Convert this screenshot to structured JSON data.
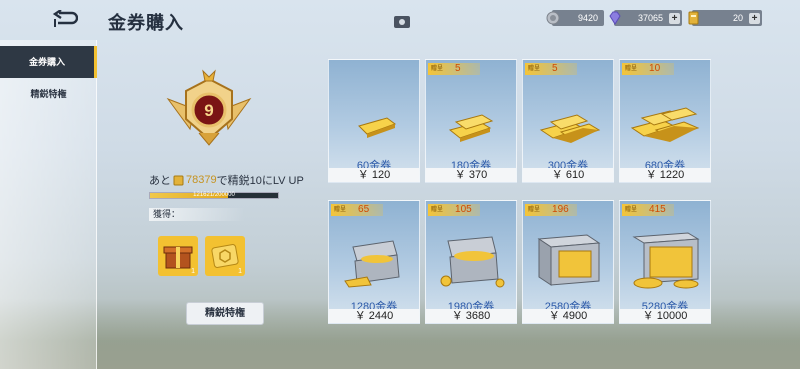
{
  "header": {
    "title": "金券購入",
    "currencies": [
      {
        "name": "silver",
        "value": "9420",
        "color": "#8a9099",
        "has_plus": false
      },
      {
        "name": "gem",
        "value": "37065",
        "color": "#8b7de0",
        "has_plus": true
      },
      {
        "name": "gold-coupon",
        "value": "20",
        "color": "#e3b23a",
        "has_plus": true
      }
    ],
    "plus_label": "+"
  },
  "sidebar": {
    "items": [
      {
        "label": "金券購入",
        "active": true
      },
      {
        "label": "精鋭特権",
        "active": false
      }
    ]
  },
  "elite": {
    "level": "9",
    "progress_prefix": "あと",
    "progress_amount": "78379",
    "progress_suffix": "で精鋭10にLV UP",
    "progress_value": "121621/200000",
    "progress_fraction": 0.608,
    "obtain_label": "獲得：",
    "rewards": [
      {
        "icon": "gift-box-icon",
        "qty": "1"
      },
      {
        "icon": "coupon-card-icon",
        "qty": "1"
      }
    ],
    "button_label": "精鋭特権"
  },
  "packs": [
    {
      "name": "60金券",
      "price": "￥ 120",
      "bonus": null
    },
    {
      "name": "180金券",
      "price": "￥ 370",
      "bonus": "5"
    },
    {
      "name": "300金券",
      "price": "￥ 610",
      "bonus": "5"
    },
    {
      "name": "680金券",
      "price": "￥ 1220",
      "bonus": "10"
    },
    {
      "name": "1280金券",
      "price": "￥ 2440",
      "bonus": "65"
    },
    {
      "name": "1980金券",
      "price": "￥ 3680",
      "bonus": "105"
    },
    {
      "name": "2580金券",
      "price": "￥ 4900",
      "bonus": "196"
    },
    {
      "name": "5280金券",
      "price": "￥ 10000",
      "bonus": "415"
    }
  ],
  "bonus_label": "贈呈",
  "colors": {
    "accent_gold": "#f3c131",
    "price_blue": "#2a58a8",
    "dark_panel": "#2e3844"
  }
}
